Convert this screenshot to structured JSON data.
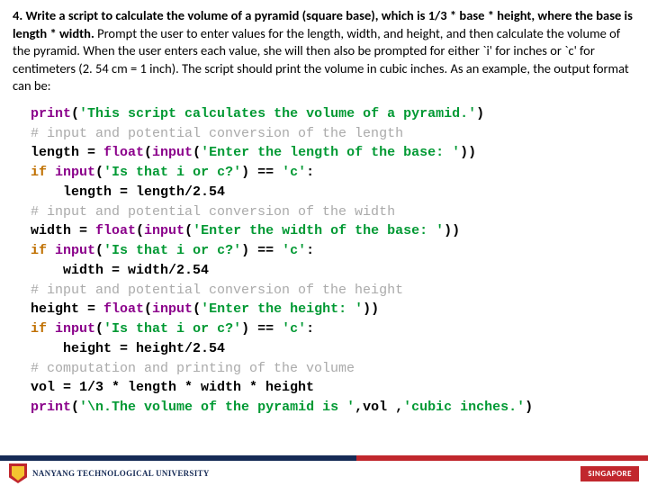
{
  "question": {
    "num": "4.",
    "bold1": "Write a script to calculate the volume of a pyramid (square base), which is 1/3 * base * height, where the base is length * width.",
    "rest": " Prompt the user to enter values for the length, width, and height, and then calculate the volume of the pyramid. When the user enters each value, she will then also be prompted for either `i' for inches or `c' for centimeters (2. 54 cm = 1 inch). The script should print the volume in cubic inches. As an example, the output format can be:"
  },
  "code": {
    "l1_print": "print",
    "l1_str": "'This script calculates the volume of a pyramid.'",
    "l2": "# input and potential conversion of the length",
    "l3_a": "length = ",
    "l3_float": "float",
    "l3_input": "input",
    "l3_str": "'Enter the length of the base: '",
    "l4_if": "if ",
    "l4_input": "input",
    "l4_str": "'Is that i or c?'",
    "l4_eq": " == ",
    "l4_c": "'c'",
    "l5": "    length = length/2.54",
    "l6": "# input and potential conversion of the width",
    "l7_a": "width = ",
    "l7_str": "'Enter the width of the base: '",
    "l8_str": "'Is that i or c?'",
    "l9": "    width = width/2.54",
    "l10": "# input and potential conversion of the height",
    "l11_a": "height = ",
    "l11_str": "'Enter the height: '",
    "l12_str": "'Is that i or c?'",
    "l13": "    height = height/2.54",
    "l14": "# computation and printing of the volume",
    "l15": "vol = 1/3 * length * width * height",
    "l16_print": "print",
    "l16_s1": "'\\n.The volume of the pyramid is '",
    "l16_mid": ",vol ,",
    "l16_s2": "'cubic inches.'"
  },
  "footer": {
    "university": "NANYANG TECHNOLOGICAL UNIVERSITY",
    "country": "SINGAPORE"
  }
}
